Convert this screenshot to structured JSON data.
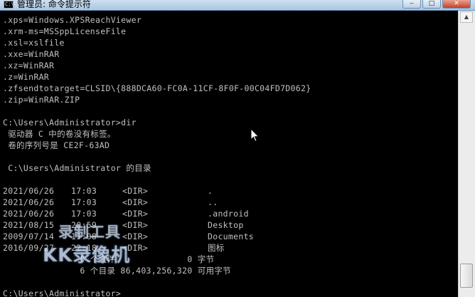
{
  "window": {
    "title": "管理员: 命令提示符",
    "icon_text": "C:\\",
    "minimize": "‒",
    "maximize": "□",
    "close": "✕"
  },
  "console": {
    "assoc_lines": [
      ".xps=Windows.XPSReachViewer",
      ".xrm-ms=MSSppLicenseFile",
      ".xsl=xslfile",
      ".xxe=WinRAR",
      ".xz=WinRAR",
      ".z=WinRAR",
      ".zfsendtotarget=CLSID\\{888DCA60-FC0A-11CF-8F0F-00C04FD7D062}",
      ".zip=WinRAR.ZIP"
    ],
    "prompt_dir": "C:\\Users\\Administrator>dir",
    "volume_label": " 驱动器 C 中的卷没有标签。",
    "volume_serial": " 卷的序列号是 CE2F-63AD",
    "dir_of": " C:\\Users\\Administrator 的目录",
    "entries": [
      {
        "date": "2021/06/26",
        "time": "17:03",
        "type": "<DIR>",
        "name": "."
      },
      {
        "date": "2021/06/26",
        "time": "17:03",
        "type": "<DIR>",
        "name": ".."
      },
      {
        "date": "2021/06/26",
        "time": "17:03",
        "type": "<DIR>",
        "name": ".android"
      },
      {
        "date": "2021/08/15",
        "time": "20:59",
        "type": "<DIR>",
        "name": "Desktop"
      },
      {
        "date": "2009/07/14",
        "time": "19:08",
        "type": "<DIR>",
        "name": "Documents"
      },
      {
        "date": "2016/09/27",
        "time": "22:18",
        "type": "<DIR>",
        "name": "图标"
      }
    ],
    "files_summary": "               0 个文件              0 字节",
    "dirs_summary": "               6 个目录 86,403,256,320 可用字节",
    "prompt_final": "C:\\Users\\Administrator>"
  },
  "watermark": {
    "line1": "录制工具",
    "line2": "KK录像机"
  }
}
